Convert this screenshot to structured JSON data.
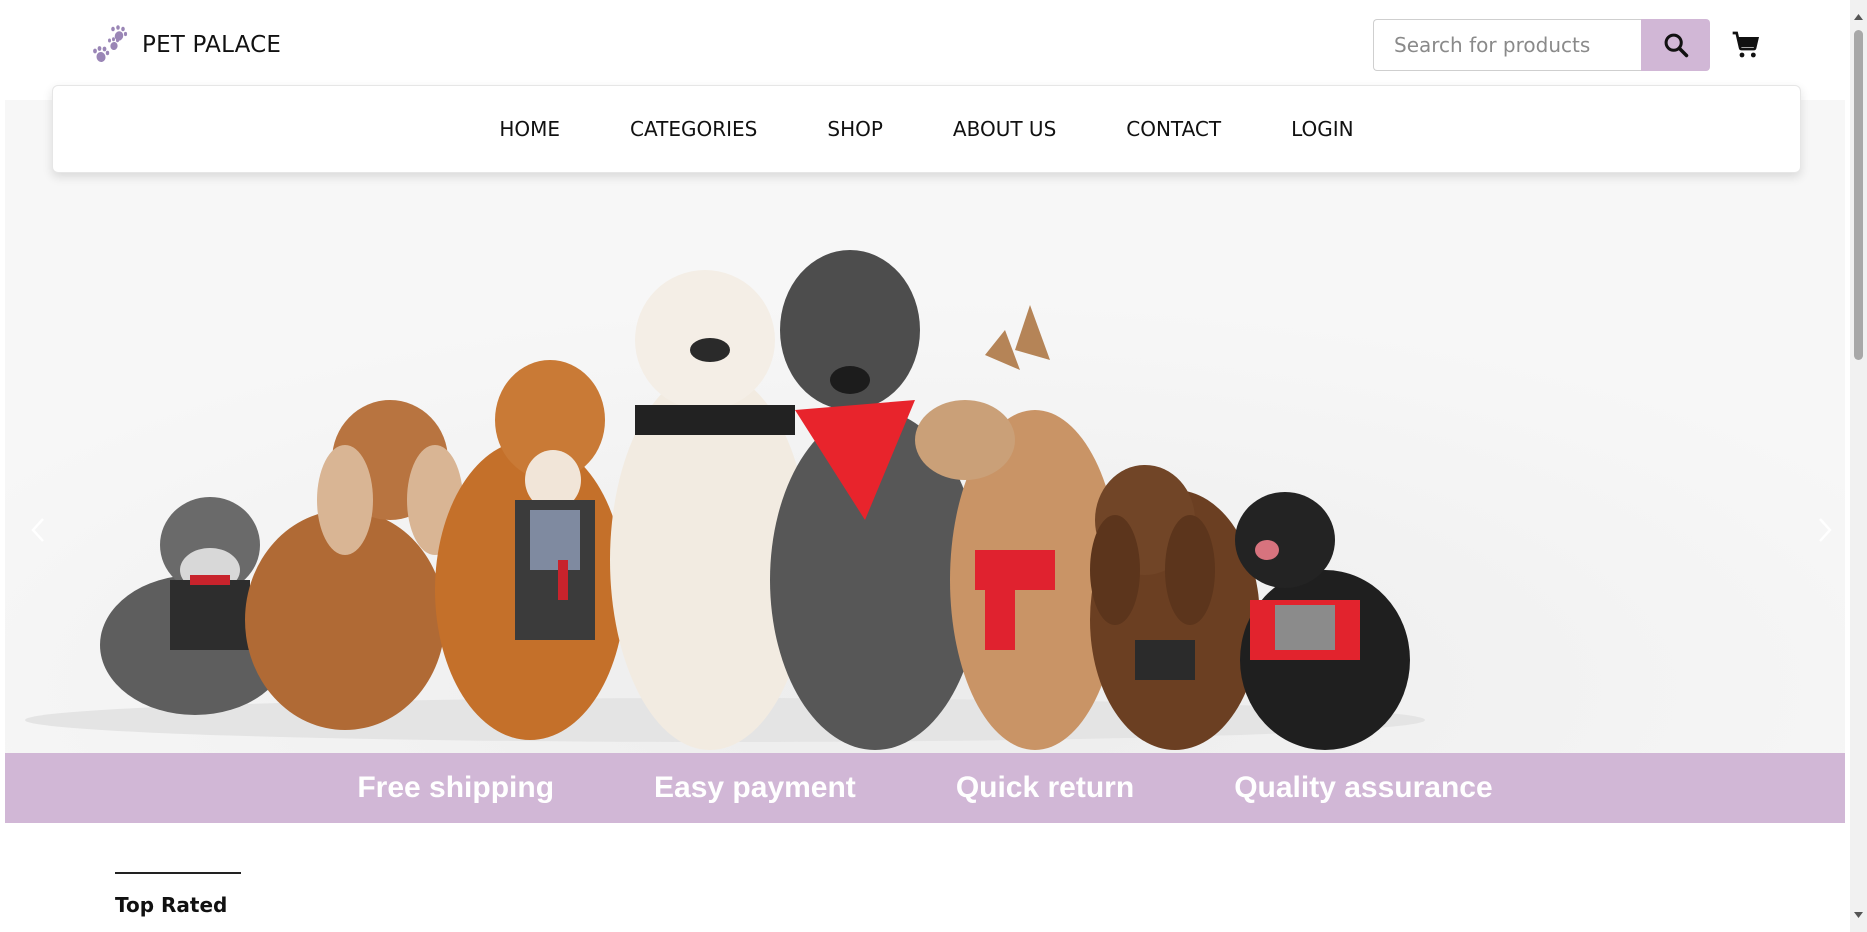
{
  "brand": {
    "name": "PET PALACE",
    "logo_icon": "paw-prints-icon",
    "logo_color": "#9a86b6"
  },
  "search": {
    "placeholder": "Search for products",
    "button_icon": "search-icon"
  },
  "cart": {
    "icon": "cart-icon"
  },
  "nav": {
    "items": [
      "HOME",
      "CATEGORIES",
      "SHOP",
      "ABOUT US",
      "CONTACT",
      "LOGIN"
    ]
  },
  "hero": {
    "image": "group of dogs sitting in a row, some wearing harnesses and a red bandana",
    "prev_icon": "chevron-left-icon",
    "next_icon": "chevron-right-icon",
    "slide_count": 3,
    "active_slide": 1
  },
  "features": [
    "Free shipping",
    "Easy payment",
    "Quick return",
    "Quality assurance"
  ],
  "sections": {
    "top_rated_title": "Top Rated"
  },
  "colors": {
    "accent": "#d1b7d6",
    "feature_text": "#ffffff",
    "text": "#111111"
  }
}
